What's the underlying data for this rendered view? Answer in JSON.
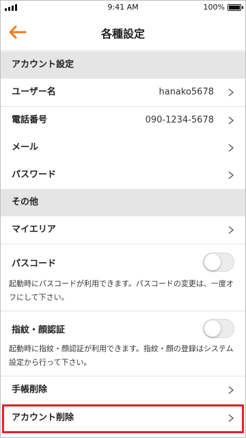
{
  "status_bar": {
    "time": "9:41 AM",
    "battery": "100%"
  },
  "header": {
    "title": "各種設定",
    "accent_color": "#f07a1a"
  },
  "sections": {
    "account": {
      "title": "アカウント設定",
      "username_label": "ユーザー名",
      "username_value": "hanako5678",
      "phone_label": "電話番号",
      "phone_value": "090-1234-5678",
      "mail_label": "メール",
      "password_label": "パスワード"
    },
    "other": {
      "title": "その他",
      "my_area_label": "マイエリア",
      "passcode_label": "パスコード",
      "passcode_enabled": false,
      "passcode_desc": "起動時にパスコードが利用できます。パスコードの変更は、一度オフにして下さい。",
      "biometric_label": "指紋・顔認証",
      "biometric_enabled": false,
      "biometric_desc": "起動時に指紋・顔認証が利用できます。指紋・顔の登録はシステム設定から行って下さい。",
      "notebook_delete_label": "手帳削除",
      "account_delete_label": "アカウント削除"
    }
  },
  "highlight_color": "#e3222a"
}
